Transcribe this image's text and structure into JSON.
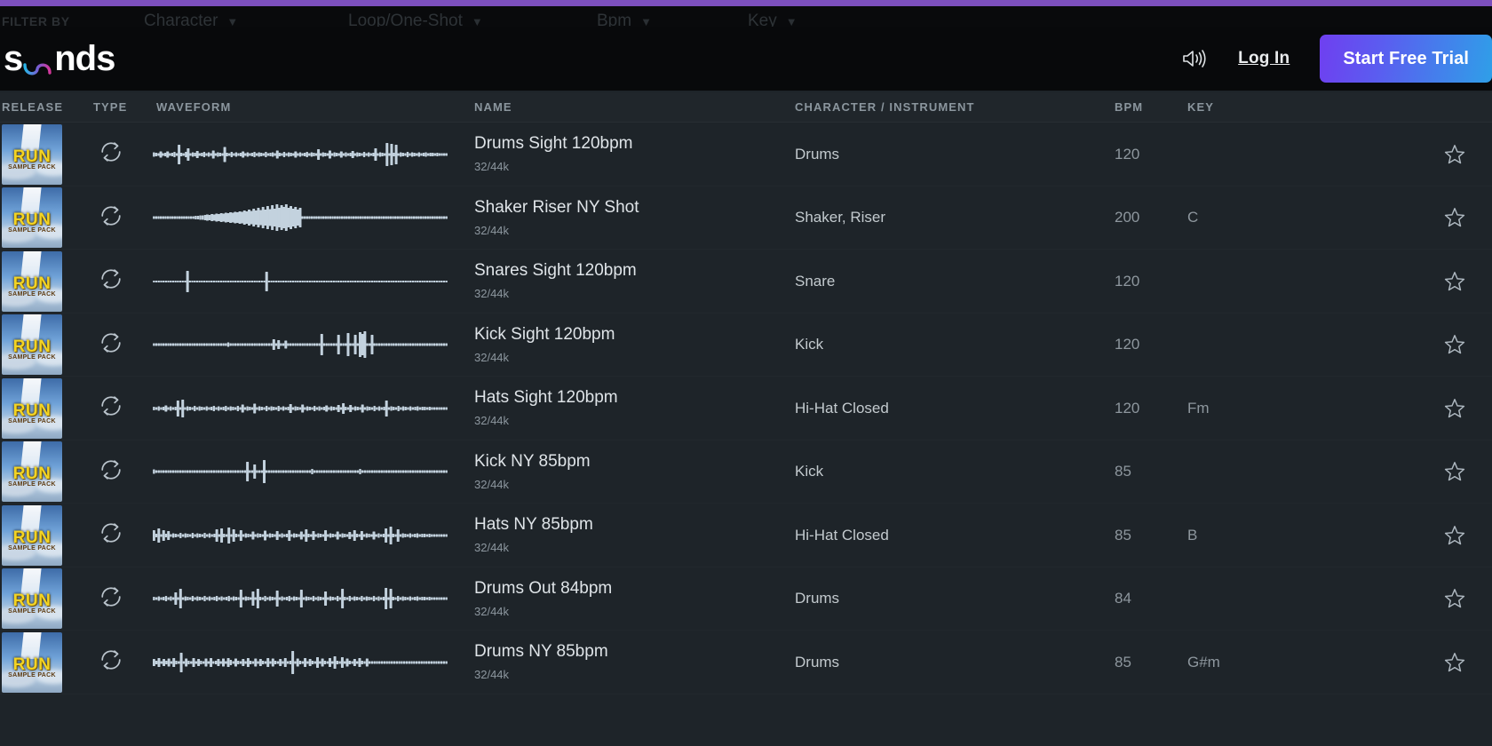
{
  "theme": {
    "accent_purple": "#7c4fbd",
    "page_bg": "#1e2429",
    "header_bg": "#08090b",
    "cta_gradient_from": "#6f3ff0",
    "cta_gradient_to": "#2f9fe8",
    "logo_wave_from": "#29b6e8",
    "logo_wave_to": "#d4379a"
  },
  "filter_bar": {
    "label": "FILTER BY",
    "items": [
      {
        "label": "Character",
        "icon": "chevron-down-icon"
      },
      {
        "label": "Loop/One-Shot",
        "icon": "chevron-down-icon"
      },
      {
        "label": "Bpm",
        "icon": "chevron-down-icon"
      },
      {
        "label": "Key",
        "icon": "chevron-down-icon"
      }
    ]
  },
  "header": {
    "logo_text_before": "s",
    "logo_text_after": "nds",
    "logo_icon": "sound-wave-icon",
    "volume_icon": "speaker-volume-icon",
    "login_label": "Log In",
    "cta_label": "Start Free Trial"
  },
  "columns": {
    "release": "RELEASE",
    "type": "TYPE",
    "waveform": "WAVEFORM",
    "name": "NAME",
    "character": "CHARACTER / INSTRUMENT",
    "bpm": "BPM",
    "key": "KEY"
  },
  "artwork": {
    "title": "RUN",
    "subtitle": "SAMPLE PACK"
  },
  "tracks": [
    {
      "name": "Drums Sight 120bpm",
      "meta": "32/44k",
      "character": "Drums",
      "bpm": "120",
      "key": "",
      "type_icon": "loop-icon",
      "star_icon": "star-outline-icon",
      "waveform": [
        5,
        4,
        3,
        7,
        3,
        4,
        7,
        3,
        4,
        6,
        3,
        22,
        4,
        3,
        6,
        14,
        3,
        5,
        4,
        8,
        3,
        4,
        6,
        3,
        5,
        3,
        9,
        3,
        5,
        4,
        3,
        17,
        4,
        3,
        6,
        3,
        5,
        3,
        4,
        7,
        3,
        5,
        3,
        4,
        6,
        3,
        5,
        4,
        3,
        6,
        3,
        4,
        5,
        3,
        9,
        4,
        3,
        6,
        3,
        5,
        4,
        3,
        7,
        3,
        5,
        3,
        4,
        6,
        3,
        5,
        4,
        3,
        12,
        3,
        5,
        4,
        3,
        9,
        3,
        5,
        4,
        3,
        7,
        3,
        5,
        3,
        4,
        8,
        3,
        5,
        4,
        3,
        6,
        3,
        5,
        3,
        4,
        14,
        3,
        5,
        4,
        3,
        26,
        3,
        24,
        4,
        22,
        3,
        5,
        4,
        3,
        6,
        3,
        5,
        4,
        3,
        5,
        3,
        4,
        5,
        3,
        4,
        4,
        3,
        4,
        3,
        3,
        3,
        3
      ]
    },
    {
      "name": "Shaker Riser NY Shot",
      "meta": "32/44k",
      "character": "Shaker, Riser",
      "bpm": "200",
      "key": "C",
      "type_icon": "loop-icon",
      "star_icon": "star-outline-icon",
      "waveform": [
        3,
        3,
        3,
        3,
        3,
        3,
        3,
        3,
        3,
        3,
        3,
        3,
        3,
        3,
        3,
        3,
        3,
        3,
        4,
        4,
        5,
        5,
        6,
        7,
        6,
        8,
        7,
        9,
        8,
        10,
        9,
        11,
        10,
        12,
        11,
        13,
        12,
        14,
        13,
        16,
        14,
        18,
        15,
        20,
        16,
        22,
        17,
        24,
        18,
        26,
        19,
        28,
        20,
        30,
        22,
        28,
        24,
        30,
        22,
        26,
        20,
        24,
        18,
        22,
        3,
        3,
        3,
        3,
        3,
        3,
        3,
        3,
        3,
        3,
        3,
        3,
        3,
        3,
        3,
        3,
        3,
        3,
        3,
        3,
        3,
        3,
        3,
        3,
        3,
        3,
        3,
        3,
        3,
        3,
        3,
        3,
        3,
        3,
        3,
        3,
        3,
        3,
        3,
        3,
        3,
        3,
        3,
        3,
        3,
        3,
        3,
        3,
        3,
        3,
        3,
        3,
        3,
        3,
        3,
        3,
        3,
        3,
        3,
        3,
        3,
        3,
        3
      ]
    },
    {
      "name": "Snares Sight 120bpm",
      "meta": "32/44k",
      "character": "Snare",
      "bpm": "120",
      "key": "",
      "type_icon": "loop-icon",
      "star_icon": "star-outline-icon",
      "waveform": [
        2,
        2,
        2,
        2,
        2,
        2,
        2,
        2,
        2,
        2,
        2,
        2,
        2,
        2,
        24,
        2,
        2,
        2,
        2,
        2,
        2,
        2,
        2,
        2,
        2,
        2,
        2,
        2,
        2,
        2,
        2,
        2,
        2,
        2,
        2,
        2,
        2,
        2,
        2,
        2,
        2,
        2,
        2,
        2,
        2,
        2,
        2,
        22,
        2,
        2,
        2,
        2,
        2,
        2,
        2,
        2,
        2,
        2,
        2,
        2,
        2,
        2,
        2,
        2,
        2,
        2,
        2,
        2,
        2,
        2,
        2,
        2,
        2,
        2,
        2,
        2,
        2,
        2,
        2,
        2,
        2,
        2,
        2,
        2,
        2,
        2,
        2,
        2,
        2,
        2,
        2,
        2,
        2,
        2,
        2,
        2,
        2,
        2,
        2,
        2,
        2,
        2,
        2,
        2,
        2,
        2,
        2,
        2,
        2,
        2,
        2,
        2,
        2,
        2,
        2,
        2,
        2,
        2,
        2,
        2,
        2,
        2,
        2
      ]
    },
    {
      "name": "Kick Sight 120bpm",
      "meta": "32/44k",
      "character": "Kick",
      "bpm": "120",
      "key": "",
      "type_icon": "loop-icon",
      "star_icon": "star-outline-icon",
      "waveform": [
        3,
        3,
        3,
        3,
        3,
        3,
        3,
        3,
        3,
        3,
        3,
        3,
        3,
        3,
        3,
        3,
        3,
        3,
        3,
        3,
        3,
        3,
        3,
        3,
        3,
        3,
        3,
        3,
        3,
        3,
        3,
        5,
        3,
        3,
        3,
        3,
        3,
        3,
        3,
        3,
        3,
        3,
        3,
        3,
        3,
        3,
        3,
        3,
        3,
        3,
        12,
        3,
        10,
        3,
        3,
        9,
        3,
        3,
        3,
        3,
        3,
        3,
        3,
        3,
        3,
        3,
        3,
        3,
        3,
        3,
        24,
        3,
        3,
        3,
        3,
        3,
        3,
        22,
        3,
        3,
        3,
        26,
        3,
        3,
        22,
        3,
        28,
        24,
        30,
        3,
        3,
        22,
        3,
        3,
        3,
        3,
        3,
        3,
        3,
        3,
        3,
        3,
        3,
        3,
        3,
        3,
        3,
        3,
        3,
        3,
        3,
        3,
        3,
        3,
        3,
        3,
        3,
        3,
        3,
        3,
        3,
        3,
        3
      ]
    },
    {
      "name": "Hats Sight 120bpm",
      "meta": "32/44k",
      "character": "Hi-Hat Closed",
      "bpm": "120",
      "key": "Fm",
      "type_icon": "loop-icon",
      "star_icon": "star-outline-icon",
      "waveform": [
        4,
        3,
        5,
        3,
        4,
        7,
        3,
        5,
        3,
        4,
        18,
        3,
        20,
        3,
        5,
        4,
        3,
        6,
        3,
        5,
        4,
        3,
        5,
        3,
        4,
        6,
        3,
        5,
        3,
        4,
        6,
        3,
        5,
        4,
        3,
        6,
        3,
        9,
        3,
        5,
        4,
        3,
        11,
        3,
        5,
        4,
        3,
        6,
        3,
        5,
        4,
        3,
        6,
        3,
        5,
        3,
        4,
        10,
        3,
        5,
        4,
        3,
        9,
        3,
        5,
        4,
        3,
        6,
        3,
        5,
        3,
        4,
        7,
        3,
        5,
        4,
        3,
        8,
        3,
        12,
        4,
        3,
        8,
        3,
        5,
        4,
        3,
        9,
        3,
        5,
        4,
        3,
        6,
        3,
        5,
        3,
        4,
        18,
        3,
        5,
        4,
        3,
        6,
        3,
        5,
        4,
        3,
        5,
        3,
        4,
        5,
        3,
        4,
        4,
        3,
        4,
        3,
        3,
        3,
        3,
        3,
        3,
        3
      ]
    },
    {
      "name": "Kick NY 85bpm",
      "meta": "32/44k",
      "character": "Kick",
      "bpm": "85",
      "key": "",
      "type_icon": "loop-icon",
      "star_icon": "star-outline-icon",
      "waveform": [
        5,
        3,
        3,
        3,
        3,
        3,
        3,
        3,
        3,
        3,
        3,
        3,
        3,
        3,
        3,
        3,
        3,
        3,
        3,
        3,
        3,
        3,
        3,
        3,
        3,
        3,
        3,
        3,
        3,
        3,
        3,
        3,
        3,
        3,
        3,
        3,
        3,
        3,
        3,
        22,
        3,
        3,
        16,
        3,
        3,
        3,
        26,
        3,
        3,
        3,
        3,
        3,
        3,
        3,
        3,
        3,
        3,
        3,
        3,
        3,
        3,
        3,
        3,
        3,
        3,
        3,
        6,
        3,
        3,
        3,
        3,
        3,
        3,
        3,
        3,
        3,
        3,
        3,
        3,
        3,
        3,
        3,
        3,
        3,
        3,
        3,
        6,
        3,
        3,
        3,
        3,
        3,
        3,
        3,
        3,
        3,
        3,
        3,
        3,
        3,
        3,
        3,
        3,
        3,
        3,
        3,
        3,
        3,
        3,
        3,
        3,
        3,
        3,
        3,
        3,
        3,
        3,
        3,
        3,
        3,
        3,
        3,
        3
      ]
    },
    {
      "name": "Hats NY 85bpm",
      "meta": "32/44k",
      "character": "Hi-Hat Closed",
      "bpm": "85",
      "key": "B",
      "type_icon": "loop-icon",
      "star_icon": "star-outline-icon",
      "waveform": [
        12,
        4,
        16,
        3,
        12,
        4,
        10,
        3,
        5,
        4,
        3,
        6,
        3,
        5,
        4,
        3,
        6,
        3,
        5,
        4,
        3,
        6,
        3,
        5,
        3,
        4,
        14,
        3,
        16,
        4,
        3,
        18,
        3,
        14,
        4,
        3,
        12,
        3,
        5,
        4,
        3,
        9,
        3,
        5,
        4,
        3,
        11,
        3,
        5,
        4,
        3,
        10,
        3,
        5,
        3,
        4,
        12,
        3,
        5,
        4,
        3,
        9,
        3,
        14,
        4,
        3,
        10,
        3,
        5,
        4,
        3,
        12,
        3,
        5,
        4,
        3,
        9,
        3,
        5,
        4,
        3,
        8,
        3,
        12,
        4,
        3,
        10,
        3,
        5,
        4,
        3,
        9,
        3,
        5,
        3,
        4,
        16,
        3,
        20,
        4,
        3,
        14,
        3,
        5,
        4,
        3,
        5,
        3,
        4,
        5,
        3,
        4,
        4,
        3,
        4,
        3,
        3,
        3,
        3,
        3,
        3,
        3
      ]
    },
    {
      "name": "Drums Out 84bpm",
      "meta": "32/44k",
      "character": "Drums",
      "bpm": "84",
      "key": "",
      "type_icon": "loop-icon",
      "star_icon": "star-outline-icon",
      "waveform": [
        4,
        3,
        5,
        3,
        4,
        6,
        3,
        5,
        3,
        14,
        3,
        22,
        3,
        5,
        4,
        3,
        6,
        3,
        5,
        4,
        3,
        6,
        3,
        5,
        3,
        4,
        6,
        3,
        5,
        3,
        4,
        6,
        3,
        5,
        4,
        3,
        20,
        3,
        5,
        4,
        3,
        16,
        3,
        22,
        4,
        3,
        6,
        3,
        5,
        4,
        3,
        18,
        3,
        5,
        3,
        4,
        6,
        3,
        5,
        4,
        3,
        20,
        3,
        5,
        4,
        3,
        6,
        3,
        5,
        4,
        3,
        16,
        3,
        5,
        4,
        3,
        6,
        3,
        22,
        4,
        3,
        6,
        3,
        5,
        4,
        3,
        6,
        3,
        5,
        4,
        3,
        6,
        3,
        5,
        3,
        4,
        24,
        3,
        22,
        4,
        3,
        6,
        3,
        5,
        4,
        3,
        5,
        3,
        4,
        5,
        3,
        4,
        4,
        3,
        4,
        3,
        3,
        3,
        3,
        3,
        3,
        3
      ]
    },
    {
      "name": "Drums NY 85bpm",
      "meta": "32/44k",
      "character": "Drums",
      "bpm": "85",
      "key": "G#m",
      "type_icon": "loop-icon",
      "star_icon": "star-outline-icon",
      "waveform": [
        8,
        4,
        10,
        3,
        8,
        4,
        9,
        3,
        10,
        4,
        3,
        22,
        3,
        9,
        4,
        3,
        10,
        3,
        8,
        4,
        3,
        9,
        3,
        10,
        3,
        4,
        8,
        3,
        9,
        3,
        10,
        6,
        3,
        9,
        4,
        3,
        8,
        3,
        10,
        4,
        3,
        9,
        3,
        8,
        4,
        3,
        10,
        3,
        9,
        4,
        3,
        8,
        3,
        10,
        3,
        4,
        26,
        3,
        9,
        4,
        3,
        10,
        3,
        8,
        4,
        3,
        12,
        3,
        9,
        4,
        3,
        10,
        3,
        14,
        4,
        3,
        12,
        3,
        9,
        4,
        3,
        8,
        3,
        10,
        4,
        3,
        9,
        3,
        3,
        3,
        3,
        3,
        3,
        3,
        3,
        3,
        3,
        3,
        3,
        3,
        3,
        3,
        3,
        3,
        3,
        3,
        3,
        3,
        3,
        3,
        3,
        3,
        3,
        3,
        3,
        3,
        3,
        3,
        3
      ]
    }
  ]
}
